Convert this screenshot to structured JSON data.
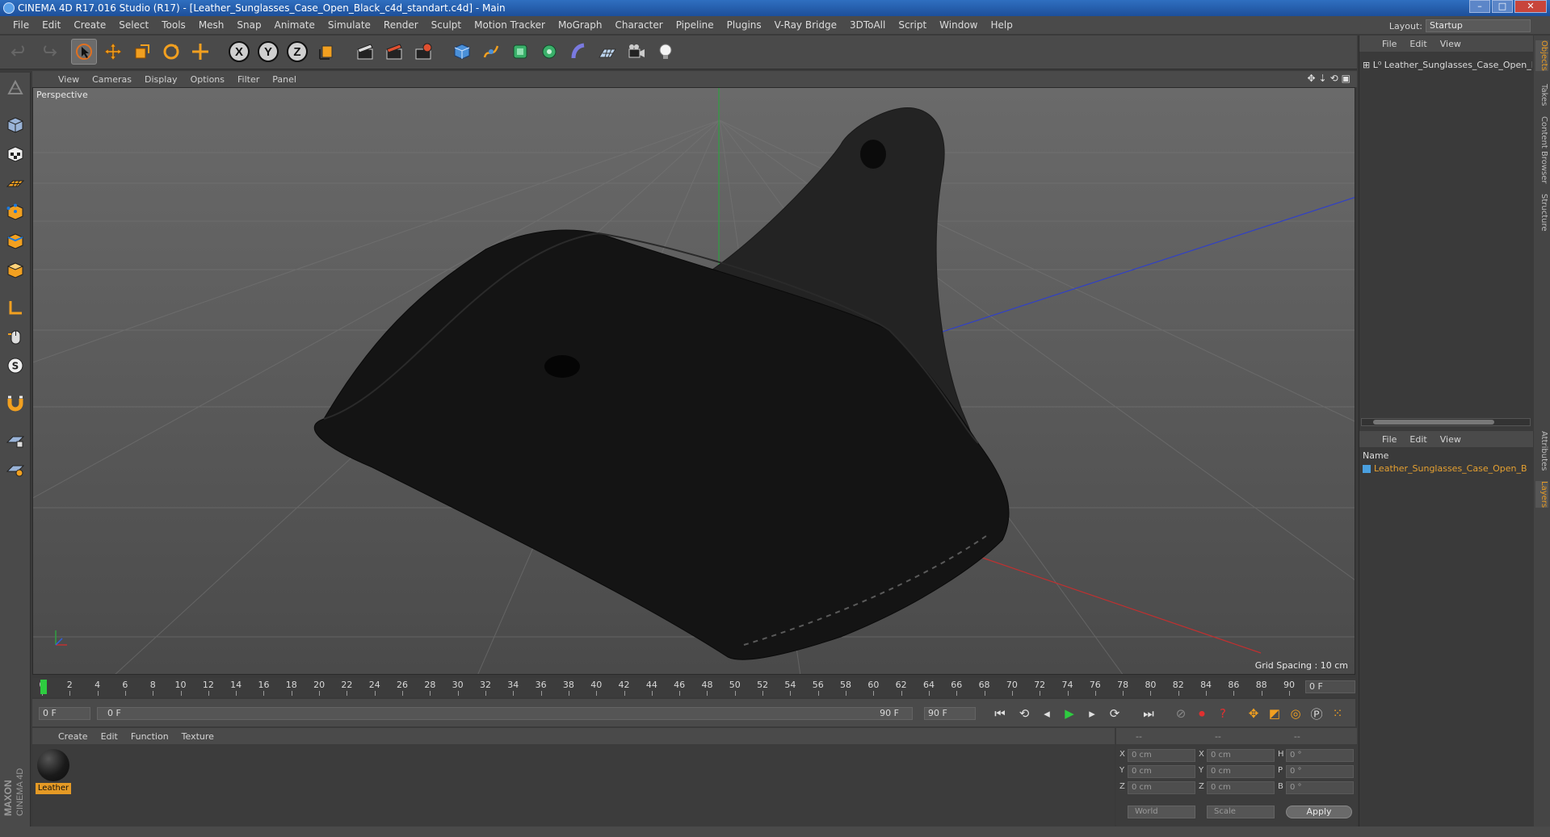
{
  "window": {
    "title": "CINEMA 4D R17.016 Studio (R17) - [Leather_Sunglasses_Case_Open_Black_c4d_standart.c4d] - Main"
  },
  "menu": [
    "File",
    "Edit",
    "Create",
    "Select",
    "Tools",
    "Mesh",
    "Snap",
    "Animate",
    "Simulate",
    "Render",
    "Sculpt",
    "Motion Tracker",
    "MoGraph",
    "Character",
    "Pipeline",
    "Plugins",
    "V-Ray Bridge",
    "3DToAll",
    "Script",
    "Window",
    "Help"
  ],
  "layout": {
    "label": "Layout:",
    "value": "Startup"
  },
  "viewport": {
    "menu": [
      "View",
      "Cameras",
      "Display",
      "Options",
      "Filter",
      "Panel"
    ],
    "label": "Perspective",
    "grid_spacing": "Grid Spacing : 10 cm"
  },
  "timeline": {
    "ticks": [
      "0",
      "2",
      "4",
      "6",
      "8",
      "10",
      "12",
      "14",
      "16",
      "18",
      "20",
      "22",
      "24",
      "26",
      "28",
      "30",
      "32",
      "34",
      "36",
      "38",
      "40",
      "42",
      "44",
      "46",
      "48",
      "50",
      "52",
      "54",
      "56",
      "58",
      "60",
      "62",
      "64",
      "66",
      "68",
      "70",
      "72",
      "74",
      "76",
      "78",
      "80",
      "82",
      "84",
      "86",
      "88",
      "90"
    ],
    "current_frame": "0 F"
  },
  "playback": {
    "start_field": "0 F",
    "range_start": "0 F",
    "range_end": "90 F",
    "end_field": "90 F"
  },
  "materials": {
    "menu": [
      "Create",
      "Edit",
      "Function",
      "Texture"
    ],
    "items": [
      {
        "name": "Leather"
      }
    ]
  },
  "coordinates": {
    "header": [
      "--",
      "--",
      "--"
    ],
    "rows": [
      {
        "l1": "X",
        "v1": "0 cm",
        "l2": "X",
        "v2": "0 cm",
        "l3": "H",
        "v3": "0 °"
      },
      {
        "l1": "Y",
        "v1": "0 cm",
        "l2": "Y",
        "v2": "0 cm",
        "l3": "P",
        "v3": "0 °"
      },
      {
        "l1": "Z",
        "v1": "0 cm",
        "l2": "Z",
        "v2": "0 cm",
        "l3": "B",
        "v3": "0 °"
      }
    ],
    "space": "World",
    "mode": "Scale",
    "apply": "Apply"
  },
  "objects_panel": {
    "menu": [
      "File",
      "Edit",
      "View"
    ],
    "items": [
      "Leather_Sunglasses_Case_Open_Bl"
    ]
  },
  "layers_panel": {
    "menu": [
      "File",
      "Edit",
      "View"
    ],
    "column": "Name",
    "items": [
      "Leather_Sunglasses_Case_Open_B"
    ]
  },
  "side_tabs": [
    "Objects",
    "Takes",
    "Content Browser",
    "Structure",
    "Attributes",
    "Layers"
  ],
  "branding": {
    "maxon": "MAXON",
    "product": "CINEMA 4D"
  },
  "colors": {
    "accent": "#e59a25",
    "axis_x": "#c0392b",
    "axis_y": "#27ae60",
    "axis_z": "#2e5cd6"
  }
}
